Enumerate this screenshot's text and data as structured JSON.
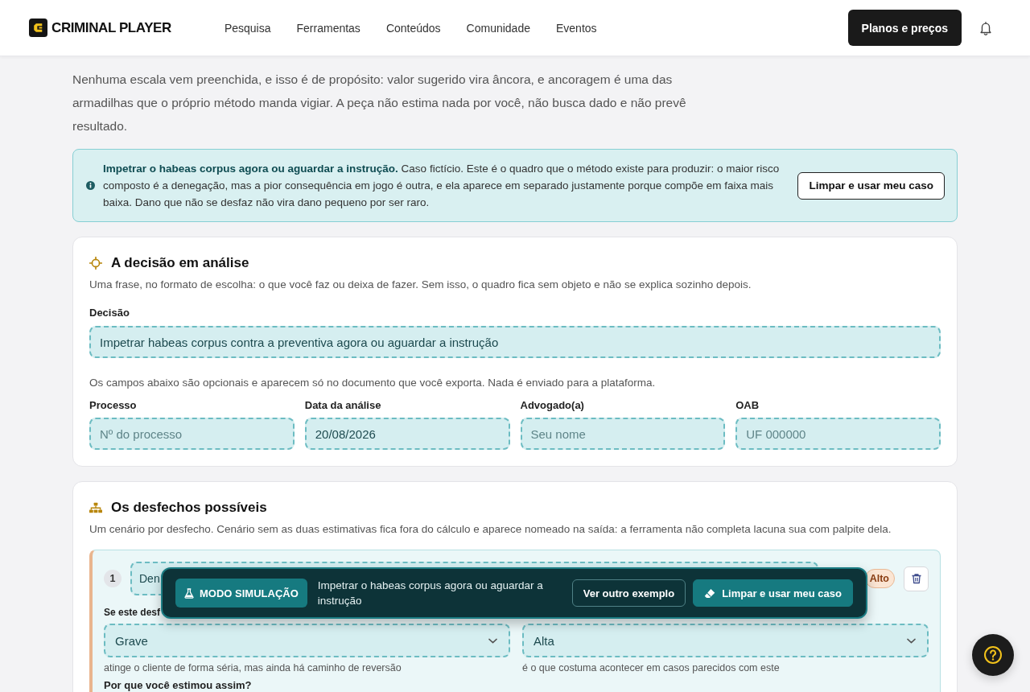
{
  "header": {
    "logo_text": "CRIMINAL PLAYER",
    "nav": [
      "Pesquisa",
      "Ferramentas",
      "Conteúdos",
      "Comunidade",
      "Eventos"
    ],
    "cta": "Planos e preços"
  },
  "intro": "Nenhuma escala vem preenchida, e isso é de propósito: valor sugerido vira âncora, e ancoragem é uma das armadilhas que o próprio método manda vigiar. A peça não estima nada por você, não busca dado e não prevê resultado.",
  "notice": {
    "text": "**Impetrar o habeas corpus agora ou aguardar a instrução.** Caso fictício. Este é o quadro que o método existe para produzir: o maior risco composto é a denegação, mas a pior consequência em jogo é outra, e ela aparece em separado justamente porque compõe em faixa mais baixa. Dano que não se desfaz não vira dano pequeno por ser raro.",
    "button": "Limpar e usar meu caso"
  },
  "decision_card": {
    "title": "A decisão em análise",
    "subtitle": "Uma frase, no formato de escolha: o que você faz ou deixa de fazer. Sem isso, o quadro fica sem objeto e não se explica sozinho depois.",
    "decision_label": "Decisão",
    "decision_value": "Impetrar habeas corpus contra a preventiva agora ou aguardar a instrução",
    "note": "Os campos abaixo são opcionais e aparecem só no documento que você exporta. Nada é enviado para a plataforma.",
    "fields": [
      {
        "label": "Processo",
        "placeholder": "Nº do processo"
      },
      {
        "label": "Data da análise",
        "value": "20/08/2026"
      },
      {
        "label": "Advogado(a)",
        "placeholder": "Seu nome"
      },
      {
        "label": "OAB",
        "placeholder": "UF 000000"
      }
    ]
  },
  "outcomes_card": {
    "title": "Os desfechos possíveis",
    "subtitle": "Um cenário por desfecho. Cenário sem as duas estimativas fica fora do cálculo e aparece nomeado na saída: a ferramenta não completa lacuna sua com palpite dela.",
    "scenarios": [
      {
        "number": "1",
        "name": "Den",
        "badge": "Alto",
        "question_label": "Se este desf",
        "estimates": [
          {
            "value": "Grave",
            "hint": "atinge o cliente de forma séria, mas ainda há caminho de reversão"
          },
          {
            "value": "Alta",
            "hint": "é o que costuma acontecer em casos parecidos com este"
          }
        ],
        "reason_label": "Por que você estimou assim?"
      }
    ]
  },
  "simulation_bar": {
    "badge": "MODO SIMULAÇÃO",
    "text": "Impetrar o habeas corpus agora ou aguardar a instrução",
    "buttons": [
      {
        "label": "Ver outro exemplo",
        "kind": "outline"
      },
      {
        "label": "Limpar e usar meu caso",
        "kind": "primary"
      }
    ]
  }
}
